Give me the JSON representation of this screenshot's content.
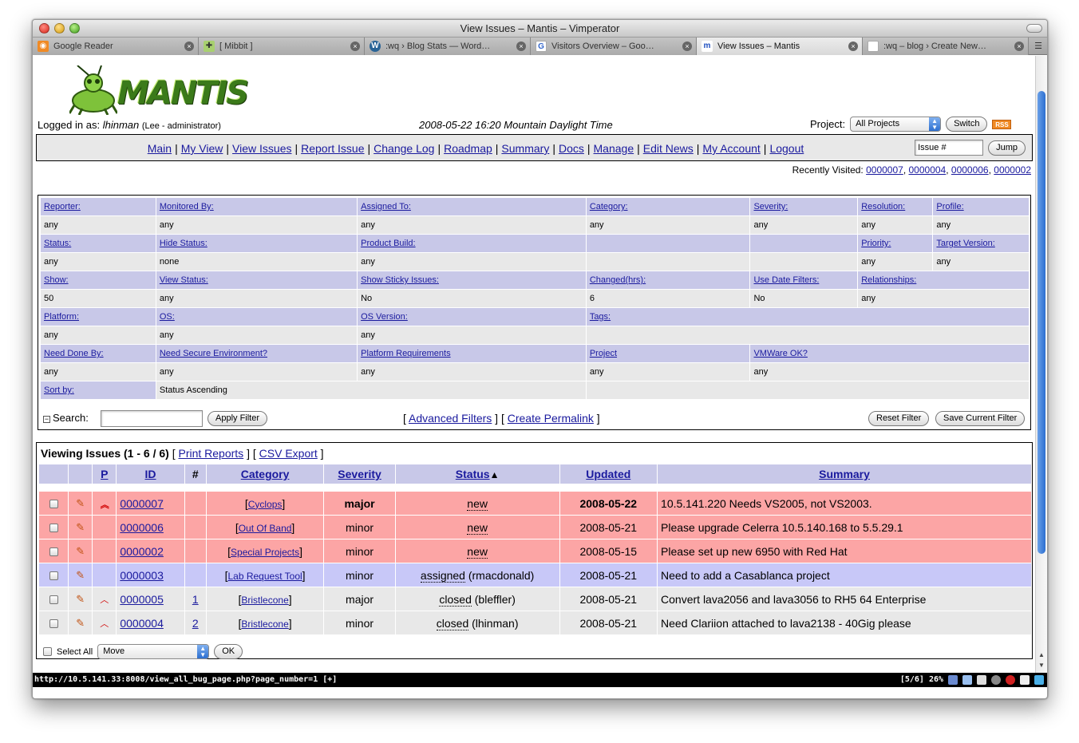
{
  "window": {
    "title": "View Issues – Mantis – Vimperator"
  },
  "tabs": [
    {
      "label": "Google Reader",
      "icon": "rss-icon",
      "active": false
    },
    {
      "label": "[ Mibbit ]",
      "icon": "mibbit-icon",
      "active": false
    },
    {
      "label": ":wq › Blog Stats — Word…",
      "icon": "wordpress-icon",
      "active": false
    },
    {
      "label": "Visitors Overview – Goo…",
      "icon": "google-icon",
      "active": false
    },
    {
      "label": "View Issues – Mantis",
      "icon": "mantis-icon",
      "active": true
    },
    {
      "label": ":wq – blog › Create New…",
      "icon": "page-icon",
      "active": false
    }
  ],
  "logo": {
    "text": "MANTIS"
  },
  "login": {
    "prefix": "Logged in as:",
    "user": "lhinman",
    "detail": "(Lee - administrator)",
    "datetime": "2008-05-22 16:20 Mountain Daylight Time",
    "project_label": "Project:",
    "project_value": "All Projects",
    "switch_label": "Switch",
    "rss_label": "RSS"
  },
  "menu": {
    "items": [
      "Main",
      "My View",
      "View Issues",
      "Report Issue",
      "Change Log",
      "Roadmap",
      "Summary",
      "Docs",
      "Manage",
      "Edit News",
      "My Account",
      "Logout"
    ],
    "jump_placeholder": "Issue #",
    "jump_label": "Jump"
  },
  "recent": {
    "label": "Recently Visited:",
    "ids": [
      "0000007",
      "0000004",
      "0000006",
      "0000002"
    ]
  },
  "filters": {
    "rows": [
      {
        "h": [
          "Reporter:",
          "Monitored By:",
          "Assigned To:",
          "Category:",
          "Severity:",
          "Resolution:",
          "Profile:"
        ],
        "v": [
          "any",
          "any",
          "any",
          "any",
          "any",
          "any",
          "any"
        ]
      },
      {
        "h": [
          "Status:",
          "Hide Status:",
          "Product Build:",
          "",
          "",
          "Priority:",
          "Target Version:"
        ],
        "v": [
          "any",
          "none",
          "any",
          "",
          "",
          "any",
          "any"
        ]
      },
      {
        "h": [
          "Show:",
          "View Status:",
          "Show Sticky Issues:",
          "Changed(hrs):",
          "Use Date Filters:",
          "Relationships:",
          ""
        ],
        "v": [
          "50",
          "any",
          "No",
          "6",
          "No",
          "any",
          ""
        ]
      },
      {
        "h": [
          "Platform:",
          "OS:",
          "OS Version:",
          "Tags:"
        ],
        "v": [
          "any",
          "any",
          "any",
          ""
        ]
      },
      {
        "h": [
          "Need Done By:",
          "Need Secure Environment?",
          "Platform Requirements",
          "Project",
          "VMWare OK?"
        ],
        "v": [
          "any",
          "any",
          "any",
          "any",
          "any"
        ]
      }
    ],
    "sort_label": "Sort by:",
    "sort_value": "Status Ascending",
    "search_label": "Search:",
    "apply_label": "Apply Filter",
    "advanced_label": "Advanced Filters",
    "permalink_label": "Create Permalink",
    "reset_label": "Reset Filter",
    "save_label": "Save Current Filter"
  },
  "issues": {
    "caption": "Viewing Issues (1 - 6 / 6)",
    "print_label": "Print Reports",
    "csv_label": "CSV Export",
    "columns": [
      "",
      "",
      "P",
      "ID",
      "#",
      "Category",
      "Severity",
      "Status",
      "Updated",
      "Summary"
    ],
    "rows": [
      {
        "kind": "new",
        "prio": "high",
        "id": "0000007",
        "notes": "",
        "category": "Cyclops",
        "severity": "major",
        "bold": true,
        "status": "new",
        "assignee": "",
        "updated": "2008-05-22",
        "summary": "10.5.141.220 Needs VS2005, not VS2003."
      },
      {
        "kind": "new",
        "prio": "",
        "id": "0000006",
        "notes": "",
        "category": "Out Of Band",
        "severity": "minor",
        "bold": false,
        "status": "new",
        "assignee": "",
        "updated": "2008-05-21",
        "summary": "Please upgrade Celerra 10.5.140.168 to 5.5.29.1"
      },
      {
        "kind": "new",
        "prio": "",
        "id": "0000002",
        "notes": "",
        "category": "Special Projects",
        "severity": "minor",
        "bold": false,
        "status": "new",
        "assignee": "",
        "updated": "2008-05-15",
        "summary": "Please set up new 6950 with Red Hat"
      },
      {
        "kind": "asg",
        "prio": "",
        "id": "0000003",
        "notes": "",
        "category": "Lab Request Tool",
        "severity": "minor",
        "bold": false,
        "status": "assigned",
        "assignee": "(rmacdonald)",
        "updated": "2008-05-21",
        "summary": "Need to add a Casablanca project"
      },
      {
        "kind": "cls",
        "prio": "low",
        "id": "0000005",
        "notes": "1",
        "category": "Bristlecone",
        "severity": "major",
        "bold": false,
        "status": "closed",
        "assignee": "(bleffler)",
        "updated": "2008-05-21",
        "summary": "Convert lava2056 and lava3056 to RH5 64 Enterprise"
      },
      {
        "kind": "cls",
        "prio": "low",
        "id": "0000004",
        "notes": "2",
        "category": "Bristlecone",
        "severity": "minor",
        "bold": false,
        "status": "closed",
        "assignee": "(lhinman)",
        "updated": "2008-05-21",
        "summary": "Need Clariion attached to lava2138 - 40Gig please"
      }
    ],
    "select_all_label": "Select All",
    "action_value": "Move",
    "ok_label": "OK"
  },
  "statusbar": {
    "url": "http://10.5.141.33:8008/view_all_bug_page.php?page_number=1 [+]",
    "position": "[5/6]",
    "percent": "26%"
  }
}
